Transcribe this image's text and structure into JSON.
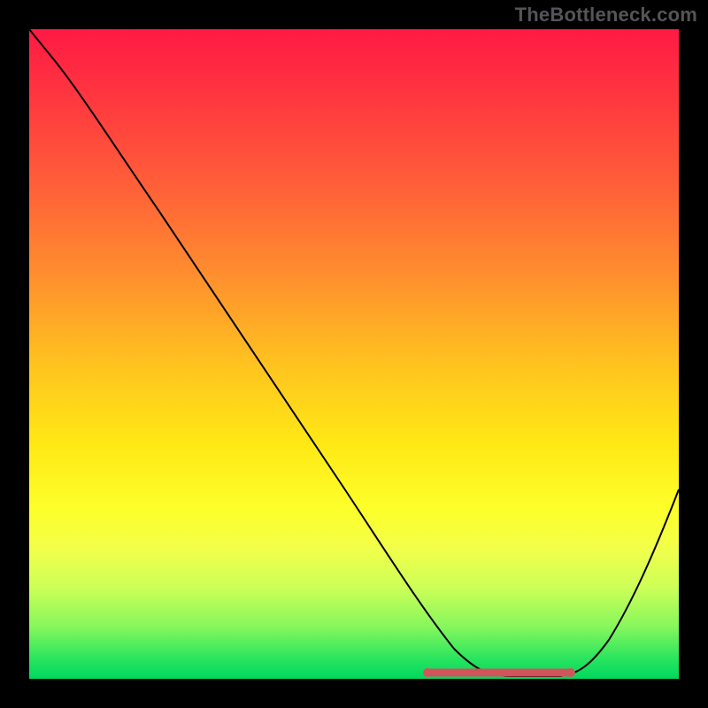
{
  "watermark": "TheBottleneck.com",
  "chart_data": {
    "type": "line",
    "title": "",
    "xlabel": "",
    "ylabel": "",
    "xlim": [
      0,
      100
    ],
    "ylim": [
      0,
      100
    ],
    "grid": false,
    "series": [
      {
        "name": "curve",
        "x": [
          0,
          4,
          10,
          20,
          30,
          40,
          50,
          56,
          60,
          64,
          70,
          76,
          80,
          86,
          92,
          100
        ],
        "values": [
          100,
          95,
          86,
          72,
          57,
          43,
          28,
          18,
          12,
          6,
          2,
          0,
          0,
          3,
          12,
          30
        ]
      }
    ],
    "flat_region": {
      "x_start": 60,
      "x_end": 82,
      "y": 0
    },
    "background_gradient": {
      "top": "#ff1a44",
      "mid": "#ffe915",
      "bottom": "#00d85e"
    },
    "highlight_color": "#d1545b"
  }
}
